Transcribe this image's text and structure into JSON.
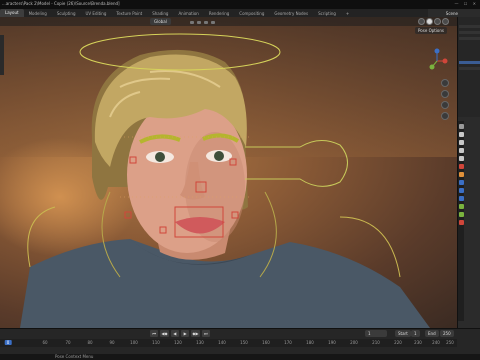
{
  "window": {
    "title": "...aracters\\Pack 2\\Model - Copie (26)\\Source\\Brenda.blend]"
  },
  "workspaces": [
    "Layout",
    "Modeling",
    "Sculpting",
    "UV Editing",
    "Texture Paint",
    "Shading",
    "Animation",
    "Rendering",
    "Compositing",
    "Geometry Nodes",
    "Scripting",
    "+"
  ],
  "active_workspace": "Layout",
  "scene": {
    "label": "Scene"
  },
  "viewport": {
    "mode": "Global",
    "pose_options": "Pose Options"
  },
  "timeline": {
    "current_frame": "1",
    "start_label": "Start",
    "start_value": "1",
    "end_label": "End",
    "end_value": "250",
    "ticks": [
      "0",
      "60",
      "70",
      "80",
      "90",
      "100",
      "110",
      "120",
      "130",
      "140",
      "150",
      "160",
      "170",
      "180",
      "190",
      "200",
      "210",
      "220",
      "230",
      "240",
      "250"
    ],
    "current_tick_label": "0"
  },
  "status": {
    "text": "Pose Context Menu"
  },
  "colors": {
    "accent": "#3b6fc5",
    "rig_yellow": "#d6d35a",
    "rig_red": "#d0463a",
    "skin": "#e0a48a",
    "hair": "#b89c58",
    "shirt": "#4a5866"
  }
}
